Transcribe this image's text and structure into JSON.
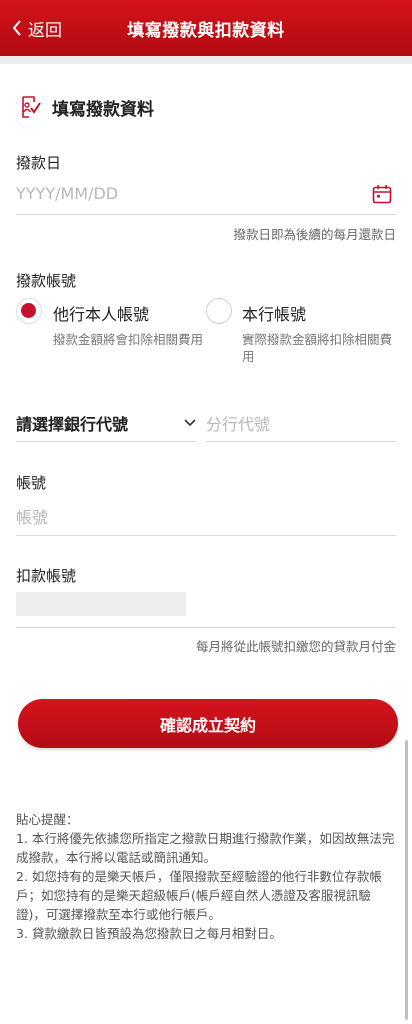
{
  "header": {
    "back_label": "返回",
    "title": "填寫撥款與扣款資料",
    "color": "#c8102e"
  },
  "section": {
    "icon": "document-check-icon",
    "title": "填寫撥款資料"
  },
  "disbursement_date": {
    "label": "撥款日",
    "placeholder": "YYYY/MM/DD",
    "icon": "calendar-icon",
    "hint": "撥款日即為後續的每月還款日"
  },
  "disbursement_account": {
    "label": "撥款帳號",
    "options": [
      {
        "label": "他行本人帳號",
        "desc": "撥款金額將會扣除相關費用",
        "selected": true
      },
      {
        "label": "本行帳號",
        "desc": "實際撥款金額將扣除相關費用",
        "selected": false
      }
    ]
  },
  "bank": {
    "select_label": "請選擇銀行代號",
    "branch_placeholder": "分行代號"
  },
  "account": {
    "label": "帳號",
    "placeholder": "帳號"
  },
  "debit_account": {
    "label": "扣款帳號",
    "value_masked": "",
    "hint": "每月將從此帳號扣繳您的貸款月付金"
  },
  "confirm_button": "確認成立契約",
  "notes": {
    "title": "貼心提醒：",
    "items": [
      "1. 本行將優先依據您所指定之撥款日期進行撥款作業，如因故無法完成撥款，本行將以電話或簡訊通知。",
      "2. 如您持有的是樂天帳戶，僅限撥款至經驗證的他行非數位存款帳戶；如您持有的是樂天超級帳戶(帳戶經自然人憑證及客服視訊驗證)，可選擇撥款至本行或他行帳戶。",
      "3. 貸款繳款日皆預設為您撥款日之每月相對日。"
    ]
  }
}
